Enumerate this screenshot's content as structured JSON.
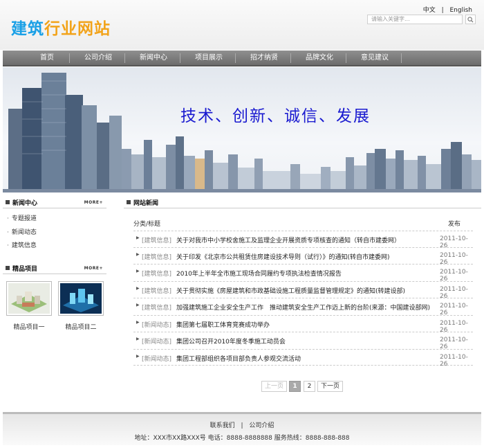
{
  "header": {
    "logo_part1": "建筑",
    "logo_part2": "行业网站",
    "lang_cn": "中文",
    "lang_sep": "|",
    "lang_en": "English",
    "search_placeholder": "请输入关键字...",
    "search_icon": "search-icon"
  },
  "nav": {
    "items": [
      "首页",
      "公司介绍",
      "新闻中心",
      "项目展示",
      "招才纳贤",
      "品牌文化",
      "意见建议"
    ]
  },
  "banner": {
    "slogan": "技术、创新、诚信、发展"
  },
  "sidebar": {
    "news_title": "新闻中心",
    "news_more": "MORE+",
    "news_links": [
      "专题报道",
      "新闻动态",
      "建筑信息"
    ],
    "projects_title": "精品项目",
    "projects_more": "MORE+",
    "projects": [
      "精品项目一",
      "精品项目二"
    ]
  },
  "main": {
    "section_title": "网站新闻",
    "col_category": "分类/标题",
    "col_date": "发布",
    "rows": [
      {
        "cat": "[建筑信息]",
        "title": "关于对我市中小学校舍施工及监理企业开展资质专项核查的通知（转自市建委网）",
        "date": "2011-10-26"
      },
      {
        "cat": "[建筑信息]",
        "title": "关于印发《北京市公共租赁住房建设技术导则（试行）》的通知(转自市建委网)",
        "date": "2011-10-26"
      },
      {
        "cat": "[建筑信息]",
        "title": "2010年上半年全市施工现场合同履约专项执法检查情况报告",
        "date": "2011-10-26"
      },
      {
        "cat": "[建筑信息]",
        "title": "关于贯彻实施《房屋建筑和市政基础设施工程质量监督管理规定》的通知(转建设部)",
        "date": "2011-10-26"
      },
      {
        "cat": "[建筑信息]",
        "title": "加强建筑施工企业安全生产工作　推动建筑安全生产工作迈上新的台阶(来源：中国建设部网)",
        "date": "2011-10-26"
      },
      {
        "cat": "[新闻动态]",
        "title": "集团第七届职工体育竞赛成功举办",
        "date": "2011-10-26"
      },
      {
        "cat": "[新闻动态]",
        "title": "集团公司召开2010年度冬季施工动员会",
        "date": "2011-10-26"
      },
      {
        "cat": "[新闻动态]",
        "title": "集团工程部组织各项目部负责人参观交流活动",
        "date": "2011-10-26"
      }
    ],
    "pager": {
      "prev": "上一页",
      "page1": "1",
      "page2": "2",
      "next": "下一页"
    }
  },
  "footer": {
    "link_contact": "联系我们",
    "link_sep": "|",
    "link_about": "公司介绍",
    "address": "地址：XXX市XX路XXX号 电话：8888-8888888 服务热线：8888-888-888"
  },
  "colors": {
    "logo_blue": "#1aa0e6",
    "logo_orange": "#f2a31a",
    "slogan": "#1a1ad0",
    "nav_bg": "#7a7a7a"
  }
}
